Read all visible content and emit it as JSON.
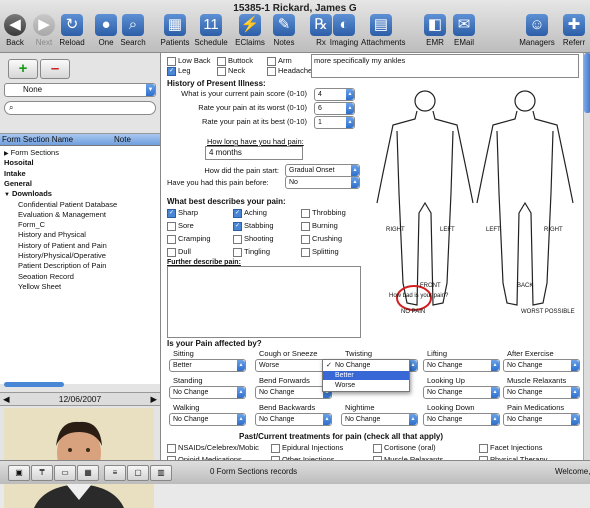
{
  "window": {
    "title": "15385-1    Rickard, James G"
  },
  "toolbar": [
    {
      "label": "Back",
      "glyph": "◀"
    },
    {
      "label": "Next",
      "glyph": "▶"
    },
    {
      "label": "Reload",
      "glyph": "↻"
    },
    {
      "label": "One",
      "glyph": "●"
    },
    {
      "label": "Search",
      "glyph": "⌕"
    },
    {
      "label": "Patients",
      "glyph": "▦"
    },
    {
      "label": "Schedule",
      "glyph": "11"
    },
    {
      "label": "EClaims",
      "glyph": "⚡"
    },
    {
      "label": "Notes",
      "glyph": "✎"
    },
    {
      "label": "Rx",
      "glyph": "℞"
    },
    {
      "label": "Imaging",
      "glyph": "◐"
    },
    {
      "label": "Attachments",
      "glyph": "▤"
    },
    {
      "label": "EMR",
      "glyph": "◧"
    },
    {
      "label": "EMail",
      "glyph": "✉"
    },
    {
      "label": "Managers",
      "glyph": "☺"
    },
    {
      "label": "Referr",
      "glyph": "✚"
    }
  ],
  "left": {
    "filter_value": "None",
    "search_placeholder": "",
    "columns": [
      "Form Section Name",
      "Note"
    ],
    "tree": [
      {
        "label": "Form Sections",
        "bold": false,
        "arrow": "▶"
      },
      {
        "label": "Hosoital",
        "bold": true,
        "arrow": ""
      },
      {
        "label": "Intake",
        "bold": true,
        "arrow": ""
      },
      {
        "label": "General",
        "bold": true,
        "arrow": ""
      },
      {
        "label": "Downloads",
        "bold": true,
        "arrow": "▼"
      },
      {
        "label": "Confidential Patient Database",
        "bold": false,
        "arrow": ""
      },
      {
        "label": "Evaluation & Management",
        "bold": false,
        "arrow": ""
      },
      {
        "label": "Form_C",
        "bold": false,
        "arrow": ""
      },
      {
        "label": "History and Physical",
        "bold": false,
        "arrow": ""
      },
      {
        "label": "History of Patient and Pain",
        "bold": false,
        "arrow": ""
      },
      {
        "label": "History/Physical/Operative",
        "bold": false,
        "arrow": ""
      },
      {
        "label": "Patient Description of Pain",
        "bold": false,
        "arrow": ""
      },
      {
        "label": "Seoation Record",
        "bold": false,
        "arrow": ""
      },
      {
        "label": "Yellow Sheet",
        "bold": false,
        "arrow": ""
      }
    ],
    "date": "12/06/2007"
  },
  "form": {
    "complaint_checks": [
      {
        "label": "Low Back",
        "checked": false
      },
      {
        "label": "Buttock",
        "checked": false
      },
      {
        "label": "Arm",
        "checked": false
      },
      {
        "label": "Leg",
        "checked": true
      },
      {
        "label": "Neck",
        "checked": false
      },
      {
        "label": "Headache",
        "checked": false
      }
    ],
    "complaint_text": "more specifically my ankles",
    "history_title": "History of Present Illness:",
    "scores": [
      {
        "label": "What is your current pain score (0-10)",
        "value": "4"
      },
      {
        "label": "Rate your pain at its worst (0-10)",
        "value": "6"
      },
      {
        "label": "Rate your pain at its best (0-10)",
        "value": "1"
      }
    ],
    "duration_label": "How long have you had pain:",
    "duration_value": "4 months",
    "start_label": "How did the pain start:",
    "start_value": "Gradual Onset",
    "before_label": "Have you had this pain before:",
    "before_value": "No",
    "describes_title": "What best describes your pain:",
    "describes": [
      {
        "label": "Sharp",
        "checked": true
      },
      {
        "label": "Aching",
        "checked": true
      },
      {
        "label": "Throbbing",
        "checked": false
      },
      {
        "label": "Sore",
        "checked": false
      },
      {
        "label": "Stabbing",
        "checked": true
      },
      {
        "label": "Burning",
        "checked": false
      },
      {
        "label": "Cramping",
        "checked": false
      },
      {
        "label": "Shooting",
        "checked": false
      },
      {
        "label": "Crushing",
        "checked": false
      },
      {
        "label": "Dull",
        "checked": false
      },
      {
        "label": "Tingling",
        "checked": false
      },
      {
        "label": "Splitting",
        "checked": false
      }
    ],
    "further_label": "Further describe pain:",
    "body_labels": {
      "right": "RIGHT",
      "left": "LEFT",
      "front": "FRONT",
      "back": "BACK"
    },
    "scale_title": "How bad is your pain?",
    "scale_min": "NO PAIN",
    "scale_max": "WORST POSSIBLE",
    "affected_title": "Is your Pain affected by?",
    "affected": [
      {
        "label": "Sitting",
        "value": "Better"
      },
      {
        "label": "Cough or Sneeze",
        "value": "Worse"
      },
      {
        "label": "Twisting",
        "value": "No Change"
      },
      {
        "label": "Lifting",
        "value": "No Change"
      },
      {
        "label": "After Exercise",
        "value": "No Change"
      },
      {
        "label": "Standing",
        "value": "No Change"
      },
      {
        "label": "Bend Forwards",
        "value": "No Change"
      },
      {
        "label": "",
        "value": ""
      },
      {
        "label": "Looking Up",
        "value": "No Change"
      },
      {
        "label": "Muscle Relaxants",
        "value": "No Change"
      },
      {
        "label": "Walking",
        "value": "No Change"
      },
      {
        "label": "Bend Backwards",
        "value": "No Change"
      },
      {
        "label": "Nightime",
        "value": "No Change"
      },
      {
        "label": "Looking Down",
        "value": "No Change"
      },
      {
        "label": "Pain Medications",
        "value": "No Change"
      }
    ],
    "popup_options": [
      {
        "label": "No Change",
        "checked": true,
        "highlight": false
      },
      {
        "label": "Better",
        "checked": false,
        "highlight": true
      },
      {
        "label": "Worse",
        "checked": false,
        "highlight": false
      }
    ],
    "treatments_title": "Past/Current treatments for pain (check all that apply)",
    "treatments": [
      {
        "label": "NSAIDs/Celebrex/Mobic"
      },
      {
        "label": "Epidural Injections"
      },
      {
        "label": "Cortisone (oral)"
      },
      {
        "label": "Facet Injections"
      },
      {
        "label": "Opioid Medications"
      },
      {
        "label": "Other Injections"
      },
      {
        "label": "Muscle Relaxants"
      },
      {
        "label": "Physical Therapy"
      }
    ]
  },
  "statusbar": {
    "records": "0 Form Sections records",
    "welcome": "Welcome,"
  }
}
